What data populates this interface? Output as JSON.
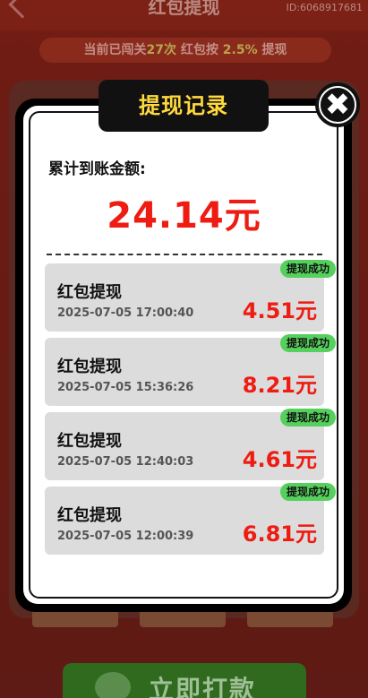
{
  "background": {
    "title": "红包提现",
    "user_id": "ID:6068917681",
    "banner": {
      "prefix": "当前已闯关",
      "count": "27次",
      "middle": " 红包按 ",
      "rate": "2.5%",
      "suffix": " 提现"
    },
    "action_button_label": "立即打款"
  },
  "modal": {
    "title": "提现记录",
    "close_icon": "close-icon",
    "total_label": "累计到账金额:",
    "total_amount": "24.14元",
    "records": [
      {
        "name": "红包提现",
        "time": "2025-07-05 17:00:40",
        "amount": "4.51元",
        "status": "提现成功"
      },
      {
        "name": "红包提现",
        "time": "2025-07-05 15:36:26",
        "amount": "8.21元",
        "status": "提现成功"
      },
      {
        "name": "红包提现",
        "time": "2025-07-05 12:40:03",
        "amount": "4.61元",
        "status": "提现成功"
      },
      {
        "name": "红包提现",
        "time": "2025-07-05 12:00:39",
        "amount": "6.81元",
        "status": "提现成功"
      }
    ]
  },
  "colors": {
    "accent_red": "#ee1c12",
    "title_yellow": "#ffd93d",
    "success_green": "#56d05d"
  }
}
